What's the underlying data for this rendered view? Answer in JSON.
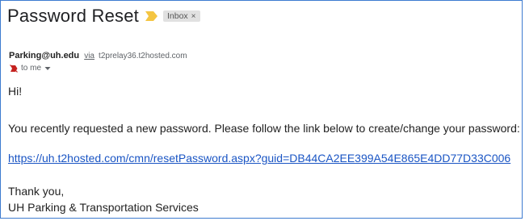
{
  "email": {
    "subject": "Password Reset",
    "label": "Inbox",
    "label_close": "×",
    "sender": "Parking@uh.edu",
    "via": "via",
    "relay": "t2prelay36.t2hosted.com",
    "to": "to me",
    "greeting": "Hi!",
    "message": "You recently requested a new password. Please follow the link below to create/change your password:",
    "link": "https://uh.t2hosted.com/cmn/resetPassword.aspx?guid=DB44CA2EE399A54E865E4DD77D33C006",
    "closing": "Thank you,",
    "signature": "UH Parking & Transportation Services"
  },
  "icons": {
    "importance": "importance-marker-icon",
    "not_important": "not-important-icon",
    "dropdown": "chevron-down-icon"
  },
  "colors": {
    "frame_border": "#3d7bd0",
    "link": "#1a55c4",
    "importance": "#f4c542"
  }
}
